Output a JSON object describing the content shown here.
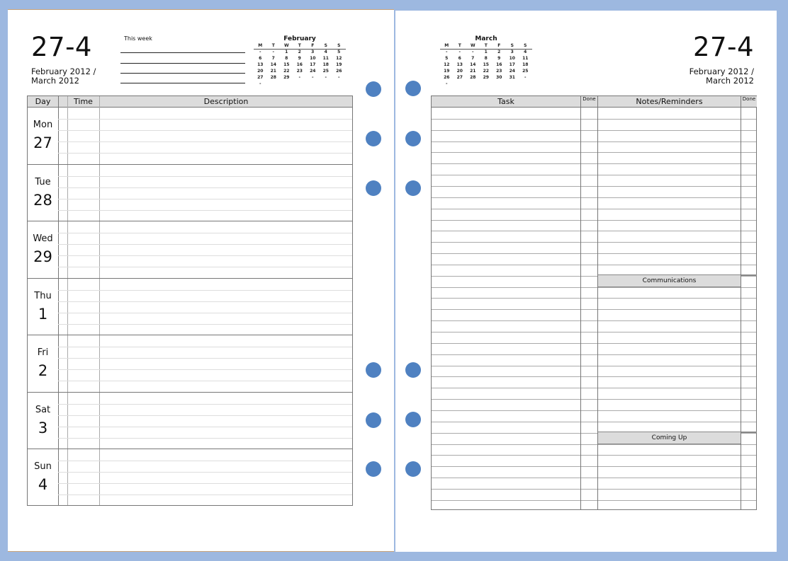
{
  "left": {
    "week_number": "27-4",
    "month_label_1": "February 2012 /",
    "month_label_2": "March 2012",
    "this_week_label": "This week",
    "mini_calendar": {
      "title": "February",
      "weekday_headers": [
        "M",
        "T",
        "W",
        "T",
        "F",
        "S",
        "S"
      ],
      "rows": [
        [
          "-",
          "-",
          "1",
          "2",
          "3",
          "4",
          "5"
        ],
        [
          "6",
          "7",
          "8",
          "9",
          "10",
          "11",
          "12"
        ],
        [
          "13",
          "14",
          "15",
          "16",
          "17",
          "18",
          "19"
        ],
        [
          "20",
          "21",
          "22",
          "23",
          "24",
          "25",
          "26"
        ],
        [
          "27",
          "28",
          "29",
          "-",
          "-",
          "-",
          "-"
        ],
        [
          "-",
          "",
          "",
          "",
          "",
          "",
          ""
        ]
      ]
    },
    "schedule": {
      "col_day": "Day",
      "col_time": "Time",
      "col_description": "Description",
      "days": [
        {
          "name": "Mon",
          "num": "27"
        },
        {
          "name": "Tue",
          "num": "28"
        },
        {
          "name": "Wed",
          "num": "29"
        },
        {
          "name": "Thu",
          "num": "1"
        },
        {
          "name": "Fri",
          "num": "2"
        },
        {
          "name": "Sat",
          "num": "3"
        },
        {
          "name": "Sun",
          "num": "4"
        }
      ]
    }
  },
  "right": {
    "week_number": "27-4",
    "month_label_1": "February 2012 /",
    "month_label_2": "March 2012",
    "mini_calendar": {
      "title": "March",
      "weekday_headers": [
        "M",
        "T",
        "W",
        "T",
        "F",
        "S",
        "S"
      ],
      "rows": [
        [
          "-",
          "-",
          "-",
          "1",
          "2",
          "3",
          "4"
        ],
        [
          "5",
          "6",
          "7",
          "8",
          "9",
          "10",
          "11"
        ],
        [
          "12",
          "13",
          "14",
          "15",
          "16",
          "17",
          "18"
        ],
        [
          "19",
          "20",
          "21",
          "22",
          "23",
          "24",
          "25"
        ],
        [
          "26",
          "27",
          "28",
          "29",
          "30",
          "31",
          "-"
        ],
        [
          "-",
          "",
          "",
          "",
          "",
          "",
          ""
        ]
      ]
    },
    "tasks": {
      "col_task": "Task",
      "col_done": "Done",
      "col_notes": "Notes/Reminders",
      "col_done2": "Done",
      "communications_label": "Communications",
      "coming_up_label": "Coming Up"
    }
  },
  "colors": {
    "background": "#9db8e0",
    "punch_hole": "#4f81c1",
    "header_fill": "#dcdcdc"
  }
}
